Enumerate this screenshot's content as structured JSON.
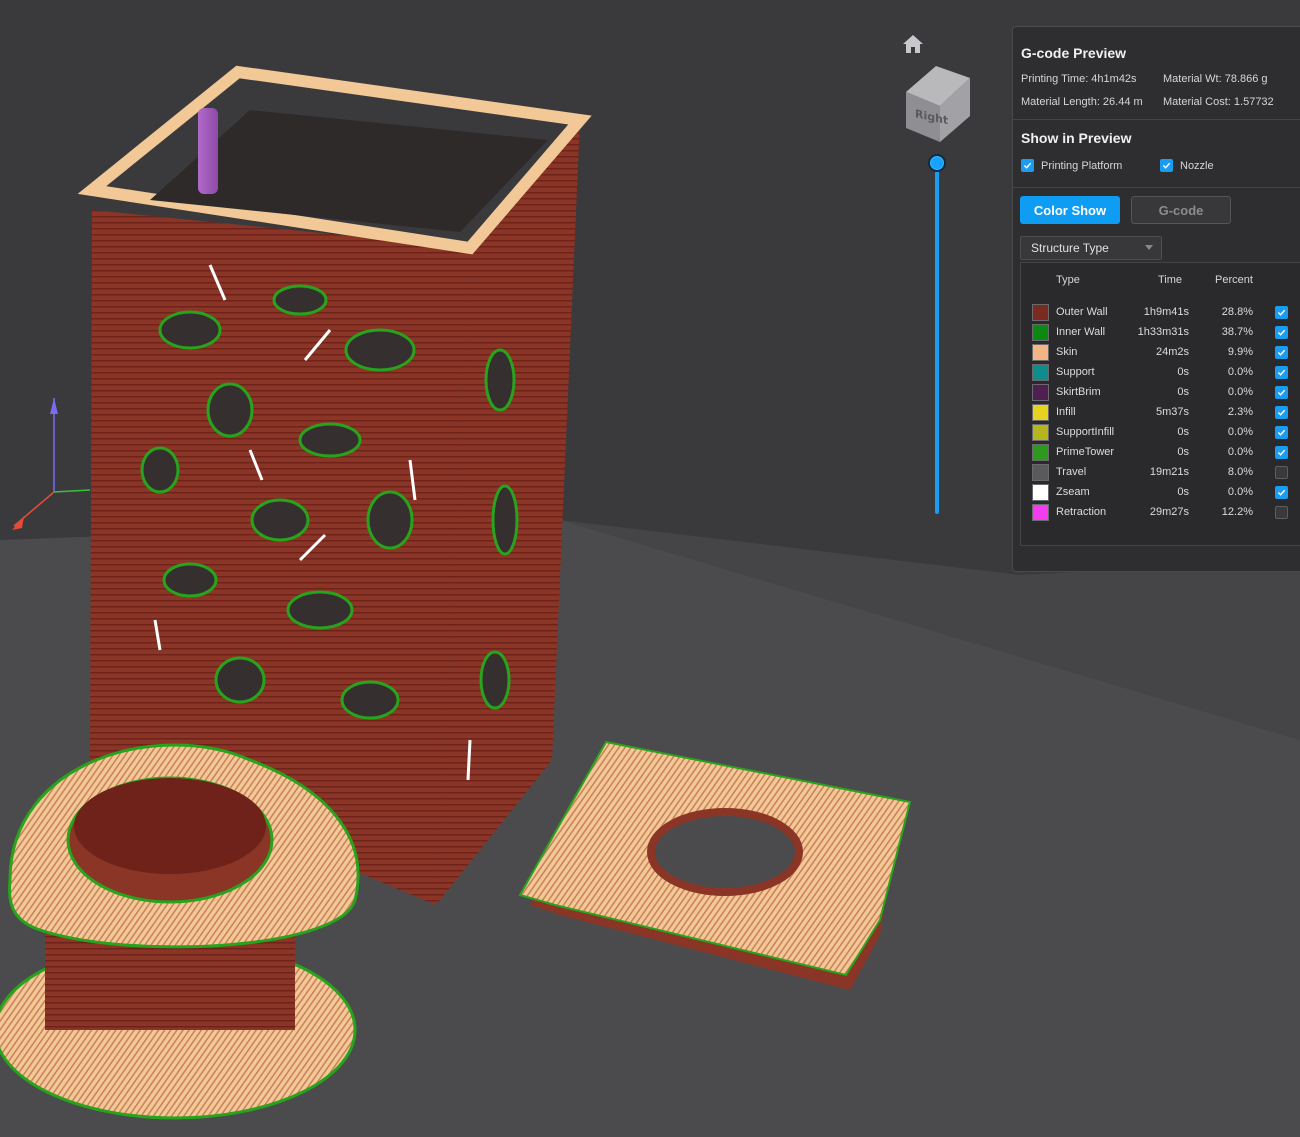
{
  "panel": {
    "title": "G-code Preview",
    "printing_time": "Printing Time: 4h1m42s",
    "material_weight": "Material Wt: 78.866 g",
    "material_length": "Material Length: 26.44 m",
    "material_cost": "Material Cost: 1.57732",
    "show_in_preview_title": "Show in Preview",
    "printing_platform_label": "Printing Platform",
    "printing_platform_checked": true,
    "nozzle_label": "Nozzle",
    "nozzle_checked": true,
    "color_show_label": "Color Show",
    "gcode_label": "G-code",
    "structure_dropdown": "Structure Type"
  },
  "legend": {
    "header_type": "Type",
    "header_time": "Time",
    "header_percent": "Percent",
    "rows": [
      {
        "type": "Outer Wall",
        "time": "1h9m41s",
        "percent": "28.8%",
        "color": "#7b2a20",
        "checked": true
      },
      {
        "type": "Inner Wall",
        "time": "1h33m31s",
        "percent": "38.7%",
        "color": "#0b8a12",
        "checked": true
      },
      {
        "type": "Skin",
        "time": "24m2s",
        "percent": "9.9%",
        "color": "#f4b585",
        "checked": true
      },
      {
        "type": "Support",
        "time": "0s",
        "percent": "0.0%",
        "color": "#0f8c8c",
        "checked": true
      },
      {
        "type": "SkirtBrim",
        "time": "0s",
        "percent": "0.0%",
        "color": "#4d2050",
        "checked": true
      },
      {
        "type": "Infill",
        "time": "5m37s",
        "percent": "2.3%",
        "color": "#e6d220",
        "checked": true
      },
      {
        "type": "SupportInfill",
        "time": "0s",
        "percent": "0.0%",
        "color": "#b5b51e",
        "checked": true
      },
      {
        "type": "PrimeTower",
        "time": "0s",
        "percent": "0.0%",
        "color": "#2c9a1e",
        "checked": true
      },
      {
        "type": "Travel",
        "time": "19m21s",
        "percent": "8.0%",
        "color": "#5a5a5c",
        "checked": false
      },
      {
        "type": "Zseam",
        "time": "0s",
        "percent": "0.0%",
        "color": "#ffffff",
        "checked": true
      },
      {
        "type": "Retraction",
        "time": "29m27s",
        "percent": "12.2%",
        "color": "#f23cf0",
        "checked": false
      }
    ]
  },
  "view_cube": {
    "face_label": "Right"
  },
  "colors": {
    "accent": "#0f9df3",
    "background": "#3a3a3c",
    "outer_wall": "#7b2a20",
    "inner_wall": "#0b8a12",
    "skin": "#f4b585"
  },
  "icons": {
    "home": "home-icon",
    "checkmark": "checkmark-icon",
    "caret": "chevron-down-icon"
  }
}
